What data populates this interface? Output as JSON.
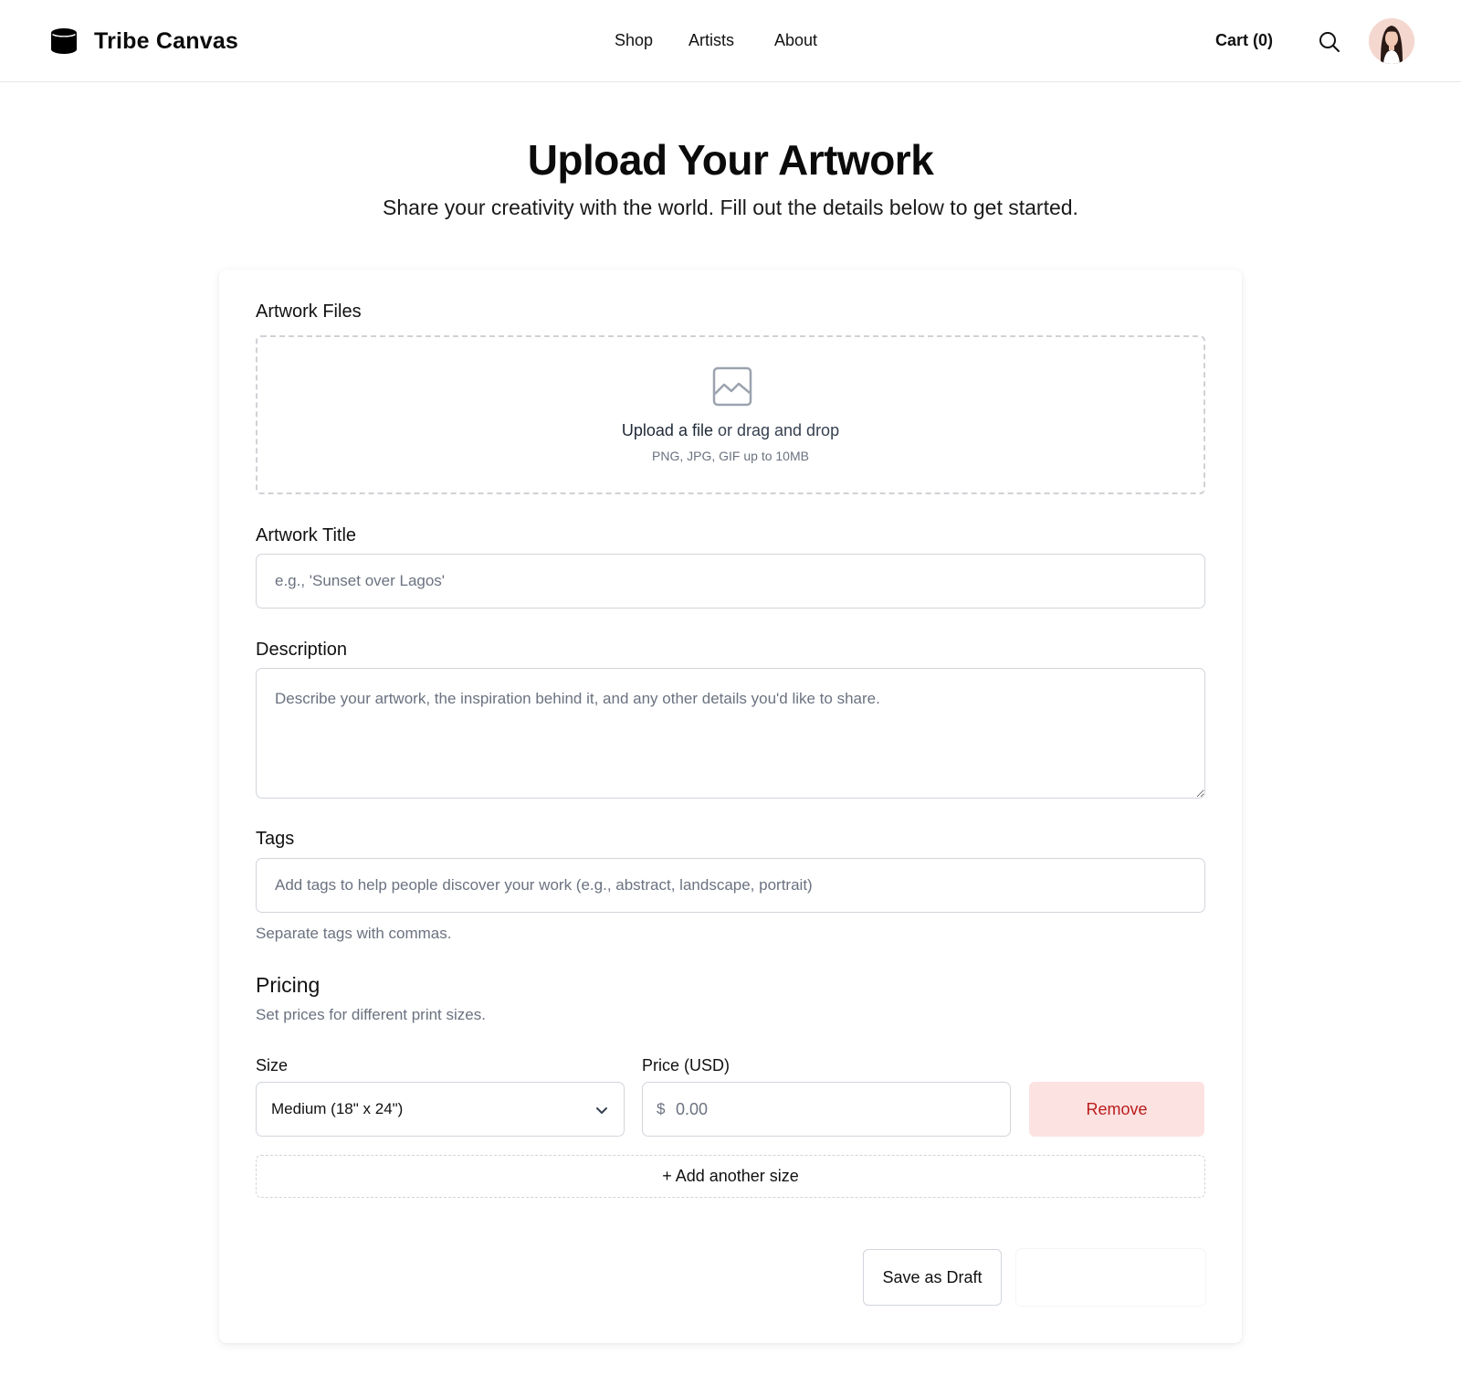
{
  "header": {
    "brand": "Tribe Canvas",
    "nav": [
      {
        "label": "Shop"
      },
      {
        "label": "Artists"
      },
      {
        "label": "About"
      }
    ],
    "cart_label": "Cart (0)"
  },
  "page": {
    "title": "Upload Your Artwork",
    "subtitle": "Share your creativity with the world. Fill out the details below to get started."
  },
  "form": {
    "files": {
      "label": "Artwork Files",
      "upload_link": "Upload a file",
      "upload_text": " or drag and drop",
      "hint": "PNG, JPG, GIF up to 10MB"
    },
    "title": {
      "label": "Artwork Title",
      "placeholder": "e.g., 'Sunset over Lagos'"
    },
    "description": {
      "label": "Description",
      "placeholder": "Describe your artwork, the inspiration behind it, and any other details you'd like to share."
    },
    "tags": {
      "label": "Tags",
      "placeholder": "Add tags to help people discover your work (e.g., abstract, landscape, portrait)",
      "help": "Separate tags with commas."
    },
    "pricing": {
      "heading": "Pricing",
      "subheading": "Set prices for different print sizes.",
      "size_label": "Size",
      "price_label": "Price (USD)",
      "size_value": "Medium (18\" x 24\")",
      "currency_symbol": "$",
      "price_placeholder": "0.00",
      "remove_label": "Remove",
      "add_label": "+ Add another size"
    },
    "actions": {
      "draft_label": "Save as Draft"
    }
  },
  "colors": {
    "remove_bg": "#fde2e2",
    "remove_text": "#b91c1c",
    "border": "#d1d5db"
  }
}
